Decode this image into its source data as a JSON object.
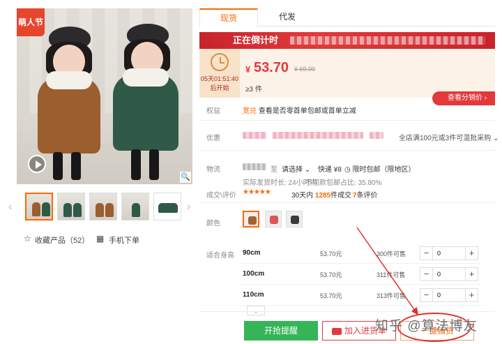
{
  "gallery": {
    "festival_badge": "萌人节",
    "thumb_count": 5
  },
  "favorites": {
    "collect_label": "收藏产品（52）",
    "mobile_label": "手机下单"
  },
  "tabs": [
    {
      "label": "现货",
      "active": true
    },
    {
      "label": "代发",
      "active": false
    }
  ],
  "promo": {
    "banner_title": "正在倒计时",
    "countdown_time": "05天01:51:40",
    "countdown_caption": "后开始"
  },
  "price": {
    "currency": "¥",
    "current": "53.70",
    "original": "¥ 69.00",
    "moq": "≥3 件"
  },
  "distribution_button": "查看分销价",
  "rights": {
    "label": "权益",
    "tag": "宽兑",
    "text": "查看是否零首单包邮或首单立减"
  },
  "discount": {
    "label": "优惠",
    "text": "全店满100元或3件可混批采购"
  },
  "logistics": {
    "label": "物流",
    "to": "至",
    "select": "请选择",
    "express": "快递 ¥8",
    "free_ship": "限时包邮（限地区）",
    "ship_time": "实际发货时长: 24小时内",
    "return_rate": "不同款包邮占比: 35.80%"
  },
  "reviews": {
    "label": "成交\\评价",
    "stars": "★★★★★",
    "days": "30天内",
    "deals": "1285",
    "deals_suffix": "件成交",
    "review_count": "7",
    "review_suffix": "条评价"
  },
  "color": {
    "label": "颜色",
    "swatches": [
      "#a0632f",
      "#d9575a",
      "#3a3a3a"
    ]
  },
  "sizes": {
    "label": "适合身高",
    "rows": [
      {
        "size": "90cm",
        "price": "53.70元",
        "stock": "300件可售",
        "qty": "0"
      },
      {
        "size": "100cm",
        "price": "53.70元",
        "stock": "311件可售",
        "qty": "0"
      },
      {
        "size": "110cm",
        "price": "53.70元",
        "stock": "313件可售",
        "qty": "0"
      }
    ]
  },
  "actions": {
    "buy": "开抢提醒",
    "cart": "加入进货单",
    "one_key": "一键铺货"
  },
  "watermark": "知乎 @算法博友"
}
